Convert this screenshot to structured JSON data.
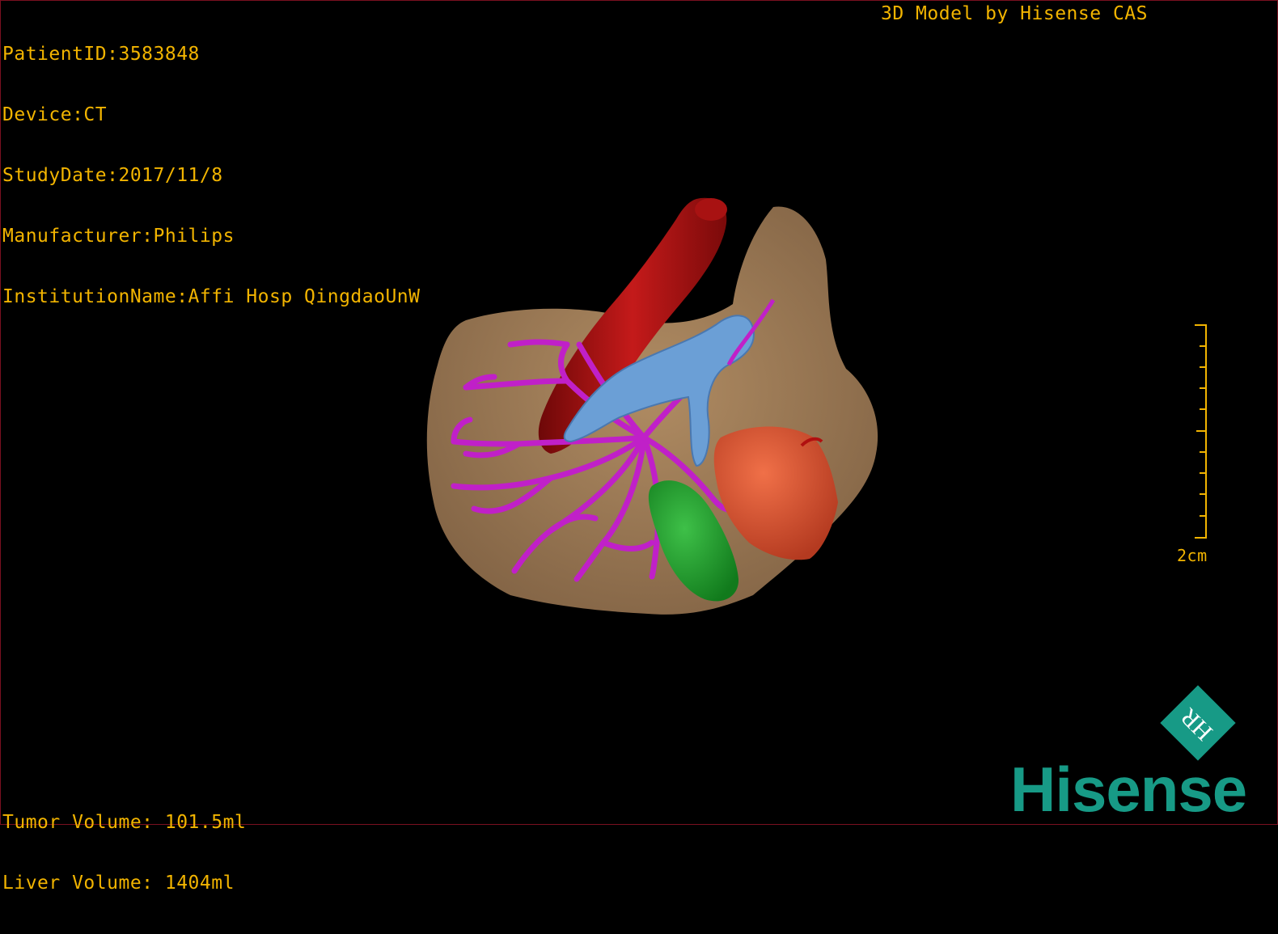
{
  "header": {
    "patient_id": "PatientID:3583848",
    "device": "Device:CT",
    "study_date": "StudyDate:2017/11/8",
    "manufacturer": "Manufacturer:Philips",
    "institution": "InstitutionName:Affi Hosp QingdaoUnW"
  },
  "vendor_title": "3D Model by Hisense CAS",
  "volumes": {
    "tumor": "Tumor Volume: 101.5ml",
    "liver": "Liver Volume: 1404ml"
  },
  "scale": {
    "label": "2cm"
  },
  "logo": {
    "word": "Hisense",
    "mark": "HR"
  },
  "colors": {
    "overlay_text": "#f2b400",
    "liver": "#9c7a56",
    "aorta": "#b01010",
    "portal_vein": "#6b9fd6",
    "hepatic_vessels": "#c020c8",
    "gallbladder": "#1f9a2a",
    "tumor": "#d4502e",
    "brand": "#179a86"
  },
  "icons": {
    "scene": "3d-liver-model",
    "logo_mark": "hr-diamond-logo"
  }
}
